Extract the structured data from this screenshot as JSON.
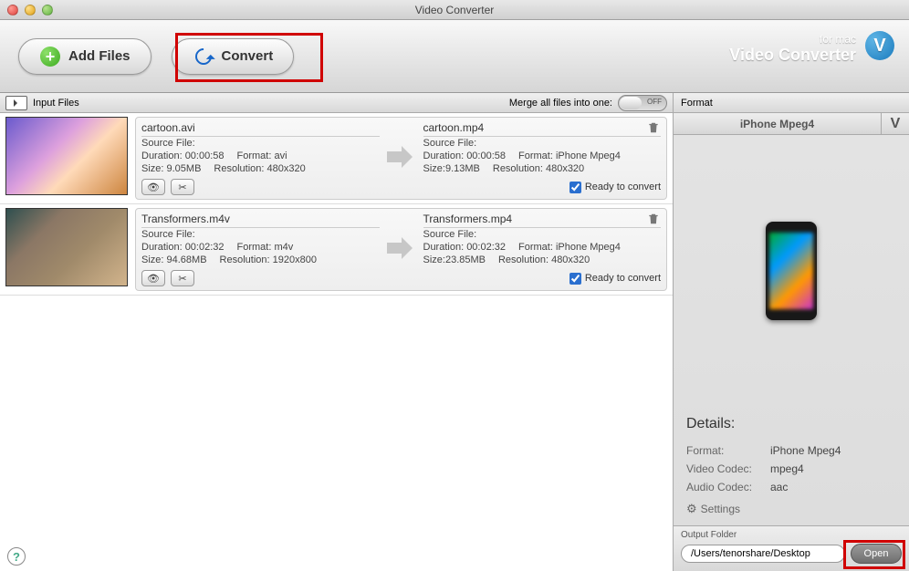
{
  "window": {
    "title": "Video Converter"
  },
  "toolbar": {
    "add_files_label": "Add Files",
    "convert_label": "Convert"
  },
  "brand": {
    "line1": "for mac",
    "line2": "Video Converter",
    "badge": "V"
  },
  "inputHeader": {
    "label": "Input Files",
    "merge_label": "Merge all files into one:",
    "toggle_state": "OFF"
  },
  "files": [
    {
      "source_name": "cartoon.avi",
      "target_name": "cartoon.mp4",
      "source": {
        "section": "Source File:",
        "duration": "Duration: 00:00:58",
        "format": "Format: avi",
        "size": "Size: 9.05MB",
        "resolution": "Resolution: 480x320"
      },
      "target": {
        "section": "Source File:",
        "duration": "Duration: 00:00:58",
        "format": "Format: iPhone Mpeg4",
        "size": "Size:9.13MB",
        "resolution": "Resolution: 480x320"
      },
      "ready_label": "Ready to convert",
      "ready_checked": true
    },
    {
      "source_name": "Transformers.m4v",
      "target_name": "Transformers.mp4",
      "source": {
        "section": "Source File:",
        "duration": "Duration: 00:02:32",
        "format": "Format: m4v",
        "size": "Size: 94.68MB",
        "resolution": "Resolution: 1920x800"
      },
      "target": {
        "section": "Source File:",
        "duration": "Duration: 00:02:32",
        "format": "Format: iPhone Mpeg4",
        "size": "Size:23.85MB",
        "resolution": "Resolution: 480x320"
      },
      "ready_label": "Ready to convert",
      "ready_checked": true
    }
  ],
  "rightPanel": {
    "header": "Format",
    "profile_name": "iPhone Mpeg4",
    "side_tab": "V",
    "details_title": "Details:",
    "format_k": "Format:",
    "format_v": "iPhone Mpeg4",
    "vcodec_k": "Video Codec:",
    "vcodec_v": "mpeg4",
    "acodec_k": "Audio Codec:",
    "acodec_v": "aac",
    "settings_label": "Settings"
  },
  "output": {
    "label": "Output Folder",
    "path": "/Users/tenorshare/Desktop",
    "open_label": "Open"
  },
  "misc": {
    "help": "?"
  }
}
